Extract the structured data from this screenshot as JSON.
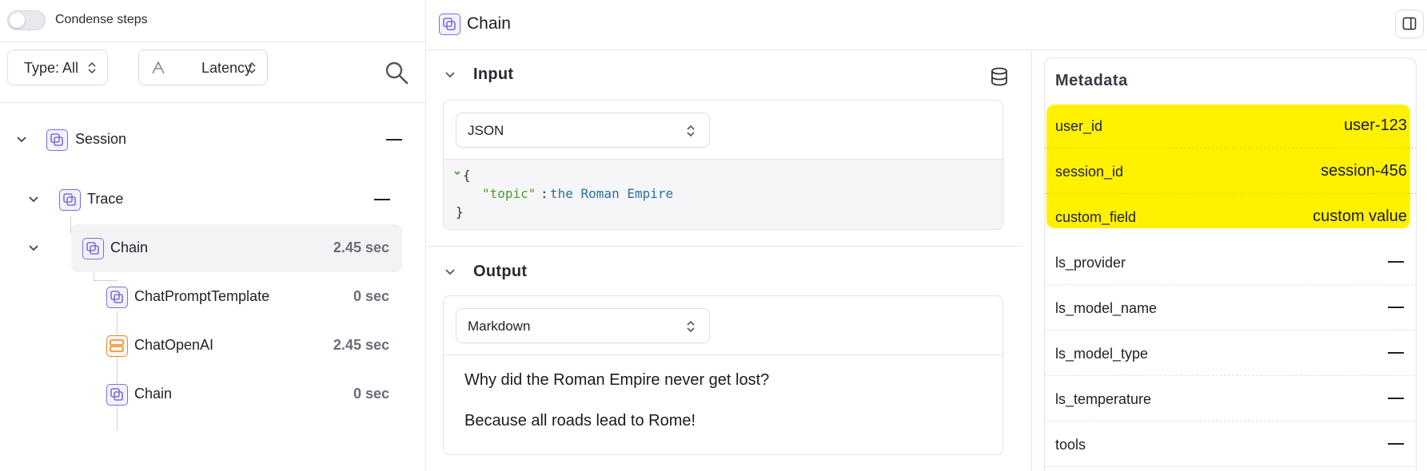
{
  "condense": {
    "label": "Condense steps",
    "enabled": false
  },
  "filters": {
    "type_label": "Type: All",
    "latency_label": "Latency"
  },
  "tree": {
    "rows": [
      {
        "label": "Session",
        "value": ""
      },
      {
        "label": "Trace",
        "value": ""
      },
      {
        "label": "Chain",
        "value": "2.45 sec"
      },
      {
        "label": "ChatPromptTemplate",
        "value": "0 sec"
      },
      {
        "label": "ChatOpenAI",
        "value": "2.45 sec"
      },
      {
        "label": "Chain",
        "value": "0 sec"
      }
    ]
  },
  "header": {
    "title": "Chain"
  },
  "input": {
    "title": "Input",
    "format": "JSON",
    "code": {
      "open": "{",
      "key": "\"topic\"",
      "colon": ":",
      "value": "the Roman Empire",
      "close": "}"
    }
  },
  "output": {
    "title": "Output",
    "format": "Markdown",
    "lines": [
      "Why did the Roman Empire never get lost?",
      "Because all roads lead to Rome!"
    ]
  },
  "metadata": {
    "title": "Metadata",
    "highlight_color": "#fff200",
    "rows": [
      {
        "key": "user_id",
        "value": "user-123"
      },
      {
        "key": "session_id",
        "value": "session-456"
      },
      {
        "key": "custom_field",
        "value": "custom value"
      },
      {
        "key": "ls_provider",
        "value": ""
      },
      {
        "key": "ls_model_name",
        "value": ""
      },
      {
        "key": "ls_model_type",
        "value": ""
      },
      {
        "key": "ls_temperature",
        "value": ""
      },
      {
        "key": "tools",
        "value": ""
      }
    ]
  },
  "colors": {
    "accent_purple": "#7c6fd0",
    "llm_orange": "#e38c2e",
    "json_key": "#4a9a2a",
    "json_value": "#2a6fa0"
  }
}
